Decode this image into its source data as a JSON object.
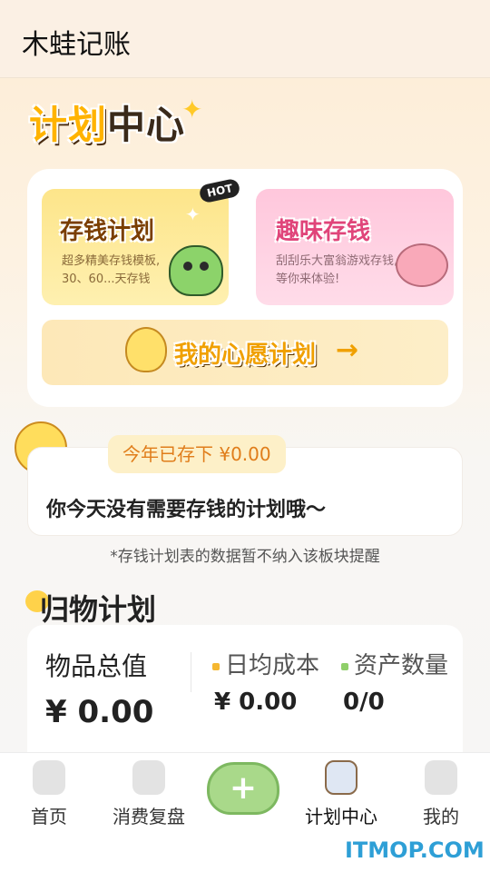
{
  "app": {
    "title": "木蛙记账"
  },
  "plan_center": {
    "banner_part1": "计划",
    "banner_part2": "中心",
    "save_plan": {
      "title": "存钱计划",
      "badge": "HOT",
      "desc": "超多精美存钱模板, 30、60...天存钱"
    },
    "fun_save": {
      "title": "趣味存钱",
      "desc": "刮刮乐大富翁游戏存钱, 等你来体验!"
    },
    "wish_plan": {
      "title": "我的心愿计划"
    }
  },
  "reminder": {
    "saved_label": "今年已存下 ¥0.00",
    "message": "你今天没有需要存钱的计划哦～",
    "note": "*存钱计划表的数据暂不纳入该板块提醒"
  },
  "goods": {
    "heading": "归物计划",
    "total_label": "物品总值",
    "total_value": "¥ 0.00",
    "avg_cost_label": "日均成本",
    "avg_cost_value": "¥ 0.00",
    "asset_count_label": "资产数量",
    "asset_count_value": "0/0",
    "avg_cost_color": "#f5b731",
    "asset_count_color": "#8fcf6a"
  },
  "tabs": [
    {
      "label": "首页"
    },
    {
      "label": "消费复盘"
    },
    {
      "label": ""
    },
    {
      "label": "计划中心"
    },
    {
      "label": "我的"
    }
  ],
  "watermark": "ITMOP.COM"
}
